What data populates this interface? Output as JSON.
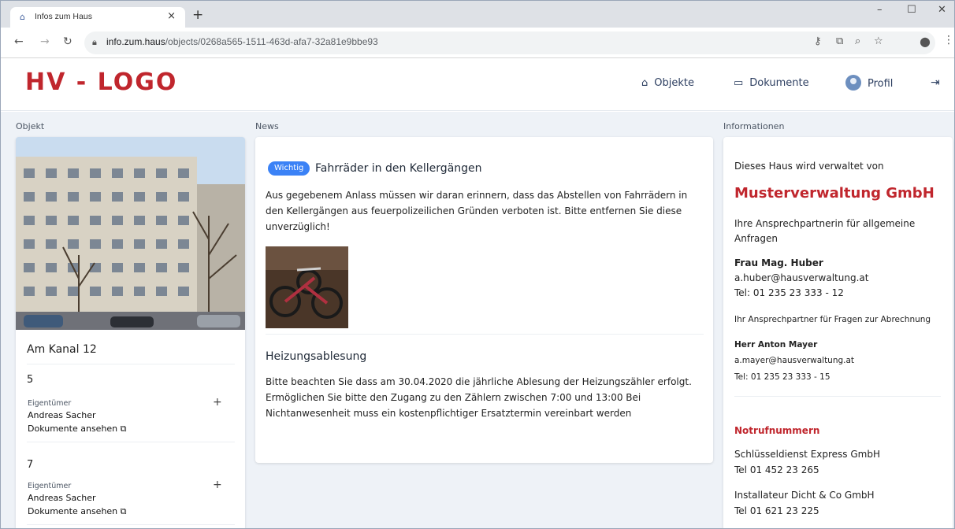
{
  "browser": {
    "tab_title": "Infos zum Haus",
    "tab_close": "×",
    "new_tab": "+",
    "url_host": "info.zum.haus",
    "url_path": "/objects/0268a565-1511-463d-afa7-32a81e9bbe93",
    "window_controls": [
      "–",
      "☐",
      "✕"
    ]
  },
  "header": {
    "logo": "HV - LOGO",
    "nav": [
      {
        "label": "Objekte",
        "icon": "home-icon"
      },
      {
        "label": "Dokumente",
        "icon": "archive-icon"
      },
      {
        "label": "Profil",
        "icon": "avatar"
      }
    ],
    "logout_icon": "logout-icon"
  },
  "sections": {
    "objekt": "Objekt",
    "news": "News",
    "info": "Informationen"
  },
  "objekt": {
    "address": "Am Kanal 12",
    "units": [
      {
        "number": "5",
        "owner_label": "Eigentümer",
        "owner_name": "Andreas Sacher",
        "doc_link": "Dokumente ansehen"
      },
      {
        "number": "7",
        "owner_label": "Eigentümer",
        "owner_name": "Andreas Sacher",
        "doc_link": "Dokumente ansehen"
      }
    ]
  },
  "news": [
    {
      "badge": "Wichtig",
      "title": "Fahrräder in den Kellergängen",
      "body": [
        "Aus gegebenem Anlass müssen wir daran erinnern, dass das Abstellen von Fahrrädern in",
        "den Kellergängen aus feuerpolizeilichen Gründen verboten ist. Bitte entfernen Sie diese",
        "unverzüglich!"
      ]
    },
    {
      "title": "Heizungsablesung",
      "body": [
        "Bitte beachten Sie dass am 30.04.2020 die jährliche Ablesung der Heizungszähler erfolgt.",
        "Ermöglichen Sie bitte den Zugang zu den Zählern zwischen 7:00 und 13:00 Bei",
        "Nichtanwesenheit muss ein kostenpflichtiger Ersatztermin vereinbart werden"
      ]
    }
  ],
  "info": {
    "managed_by": "Dieses Haus wird verwaltet von",
    "company": "Musterverwaltung GmbH",
    "contact_general_1": "Ihre Ansprechpartnerin für allgemeine",
    "contact_general_2": "Anfragen",
    "contact1_name": "Frau Mag. Huber",
    "contact1_email": "a.huber@hausverwaltung.at",
    "contact1_tel": "Tel: 01 235 23 333 - 12",
    "contact_billing": "Ihr Ansprechpartner für Fragen zur Abrechnung",
    "contact2_name": "Herr Anton Mayer",
    "contact2_email": "a.mayer@hausverwaltung.at",
    "contact2_tel": "Tel: 01 235 23 333 - 15",
    "emergency_title": "Notrufnummern",
    "emergency": [
      {
        "name": "Schlüsseldienst Express GmbH",
        "tel": "Tel 01 452 23 265"
      },
      {
        "name": "Installateur Dicht & Co GmbH",
        "tel": "Tel 01 621 23 225"
      }
    ]
  },
  "colors": {
    "brand_red": "#c0262d",
    "badge_blue": "#3b82f6",
    "background": "#eef2f7"
  }
}
